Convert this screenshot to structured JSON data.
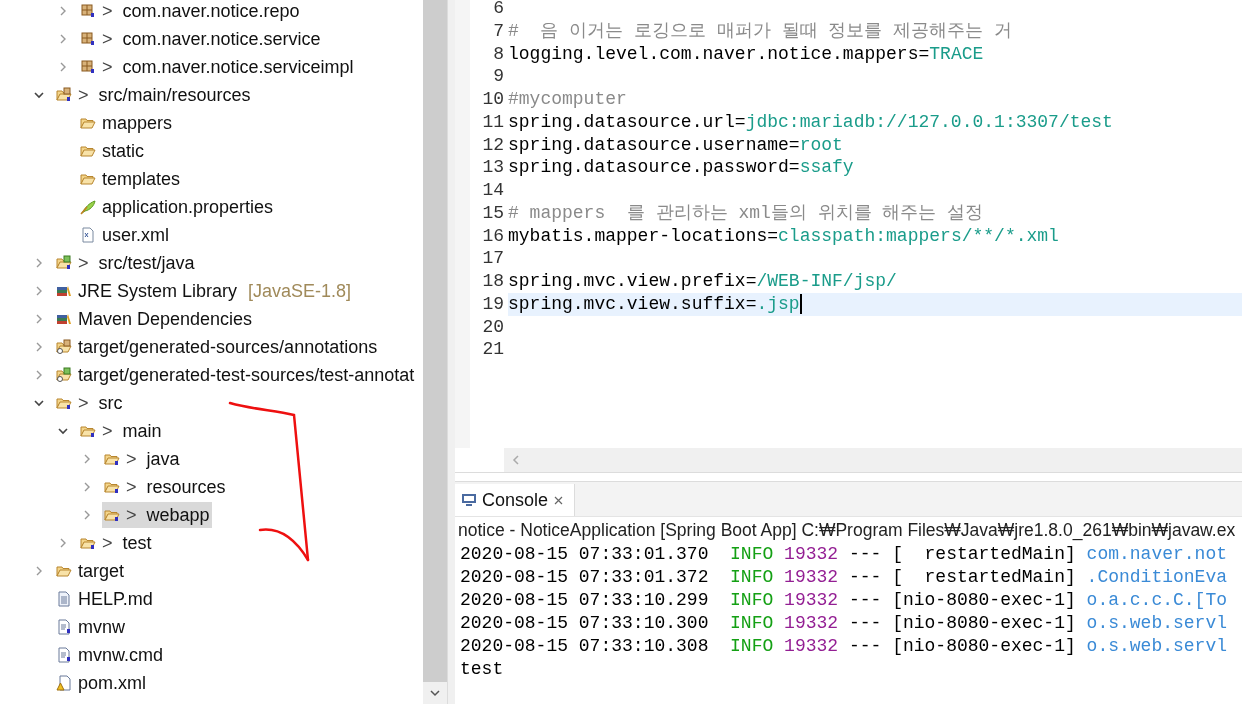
{
  "tree": [
    {
      "children": [
        {
          "kind": "package",
          "label": "com.naver.notice.repo",
          "decoration": ">",
          "expanded": false,
          "selected": false
        },
        {
          "kind": "package",
          "label": "com.naver.notice.service",
          "decoration": ">",
          "expanded": false,
          "selected": false
        },
        {
          "kind": "package",
          "label": "com.naver.notice.serviceimpl",
          "decoration": ">",
          "expanded": false,
          "selected": false
        }
      ]
    },
    {
      "kind": "source-folder",
      "label": "src/main/resources",
      "decoration": ">",
      "expanded": true,
      "selected": false,
      "children": [
        {
          "kind": "folder",
          "label": "mappers",
          "selected": false
        },
        {
          "kind": "folder",
          "label": "static",
          "selected": false
        },
        {
          "kind": "folder",
          "label": "templates",
          "selected": false
        },
        {
          "kind": "properties",
          "label": "application.properties",
          "selected": false
        },
        {
          "kind": "xml",
          "label": "user.xml",
          "selected": false
        }
      ]
    },
    {
      "kind": "test-source-folder",
      "label": "src/test/java",
      "decoration": ">",
      "expanded": false,
      "selected": false
    },
    {
      "kind": "library",
      "label": "JRE System Library",
      "qualifier": "[JavaSE-1.8]",
      "expanded": false,
      "selected": false
    },
    {
      "kind": "library",
      "label": "Maven Dependencies",
      "expanded": false,
      "selected": false
    },
    {
      "kind": "generated-folder",
      "label": "target/generated-sources/annotations",
      "expanded": false,
      "selected": false
    },
    {
      "kind": "generated-test-folder",
      "label": "target/generated-test-sources/test-annotat",
      "expanded": false,
      "selected": false
    },
    {
      "kind": "project-folder",
      "label": "src",
      "decoration": ">",
      "expanded": true,
      "selected": false,
      "children": [
        {
          "kind": "project-folder",
          "label": "main",
          "decoration": ">",
          "expanded": true,
          "selected": false,
          "children": [
            {
              "kind": "project-folder",
              "label": "java",
              "decoration": ">",
              "expanded": false,
              "selected": false
            },
            {
              "kind": "project-folder",
              "label": "resources",
              "decoration": ">",
              "expanded": false,
              "selected": false
            },
            {
              "kind": "project-folder",
              "label": "webapp",
              "decoration": ">",
              "expanded": false,
              "selected": true
            }
          ]
        },
        {
          "kind": "project-folder",
          "label": "test",
          "decoration": ">",
          "expanded": false,
          "selected": false
        }
      ]
    },
    {
      "kind": "folder",
      "label": "target",
      "expanded": false,
      "selected": false
    },
    {
      "kind": "text-file",
      "label": "HELP.md",
      "selected": false
    },
    {
      "kind": "script-file",
      "label": "mvnw",
      "selected": false
    },
    {
      "kind": "script-file",
      "label": "mvnw.cmd",
      "selected": false
    },
    {
      "kind": "pom-file",
      "label": "pom.xml",
      "selected": false
    }
  ],
  "editor": {
    "lines": [
      {
        "number": "6",
        "kind": "blank",
        "current": false
      },
      {
        "number": "7",
        "kind": "comment",
        "text": "#  음 이거는 로깅으로 매퍼가 될때 정보를 제공해주는 거",
        "current": false
      },
      {
        "number": "8",
        "kind": "property",
        "key": "logging.level.com.naver.notice.mappers=",
        "value": "TRACE",
        "current": false
      },
      {
        "number": "9",
        "kind": "blank",
        "current": false
      },
      {
        "number": "10",
        "kind": "comment",
        "text": "#mycomputer",
        "current": false
      },
      {
        "number": "11",
        "kind": "property",
        "key": "spring.datasource.url=",
        "value": "jdbc:mariadb://127.0.0.1:3307/test",
        "current": false
      },
      {
        "number": "12",
        "kind": "property",
        "key": "spring.datasource.username=",
        "value": "root",
        "current": false
      },
      {
        "number": "13",
        "kind": "property",
        "key": "spring.datasource.password=",
        "value": "ssafy",
        "current": false
      },
      {
        "number": "14",
        "kind": "blank",
        "current": false
      },
      {
        "number": "15",
        "kind": "comment",
        "text": "# mappers  를 관리하는 xml들의 위치를 해주는 설정",
        "current": false
      },
      {
        "number": "16",
        "kind": "property",
        "key": "mybatis.mapper-locations=",
        "value": "classpath:mappers/**/*.xml",
        "current": false
      },
      {
        "number": "17",
        "kind": "blank",
        "current": false
      },
      {
        "number": "18",
        "kind": "property",
        "key": "spring.mvc.view.prefix=",
        "value": "/WEB-INF/jsp/",
        "current": false
      },
      {
        "number": "19",
        "kind": "property",
        "key": "spring.mvc.view.suffix=",
        "value": ".jsp",
        "current": true
      },
      {
        "number": "20",
        "kind": "blank",
        "current": false
      },
      {
        "number": "21",
        "kind": "blank",
        "current": false
      }
    ]
  },
  "console": {
    "tab": {
      "label": "Console",
      "selected": true
    },
    "title": "notice - NoticeApplication [Spring Boot App] C:₩Program Files₩Java₩jre1.8.0_261₩bin₩javaw.ex",
    "lines": [
      {
        "kind": "log",
        "time": "2020-08-15 07:33:01.370",
        "level": "INFO",
        "pid": "19332",
        "sep": "---",
        "thread": "[  restartedMain]",
        "logger": "com.naver.not"
      },
      {
        "kind": "log",
        "time": "2020-08-15 07:33:01.372",
        "level": "INFO",
        "pid": "19332",
        "sep": "---",
        "thread": "[  restartedMain]",
        "logger": ".ConditionEva"
      },
      {
        "kind": "log",
        "time": "2020-08-15 07:33:10.299",
        "level": "INFO",
        "pid": "19332",
        "sep": "---",
        "thread": "[nio-8080-exec-1]",
        "logger": "o.a.c.c.C.[To"
      },
      {
        "kind": "log",
        "time": "2020-08-15 07:33:10.300",
        "level": "INFO",
        "pid": "19332",
        "sep": "---",
        "thread": "[nio-8080-exec-1]",
        "logger": "o.s.web.servl"
      },
      {
        "kind": "log",
        "time": "2020-08-15 07:33:10.308",
        "level": "INFO",
        "pid": "19332",
        "sep": "---",
        "thread": "[nio-8080-exec-1]",
        "logger": "o.s.web.servl"
      },
      {
        "kind": "text",
        "text": "test"
      }
    ]
  }
}
